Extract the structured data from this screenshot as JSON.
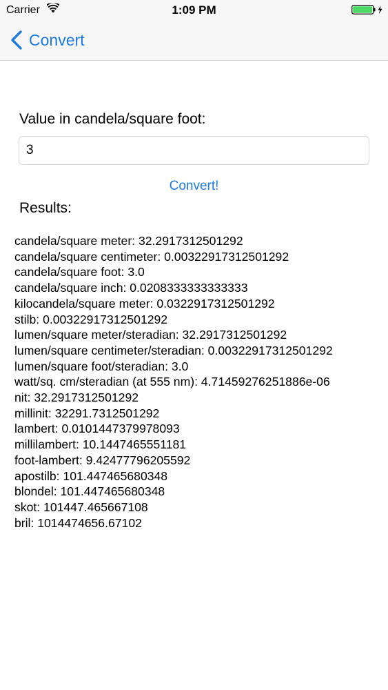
{
  "status_bar": {
    "carrier": "Carrier",
    "time": "1:09 PM",
    "battery_color": "#4cd964"
  },
  "nav": {
    "back_label": "Convert",
    "accent_color": "#1d7ae0"
  },
  "form": {
    "field_label": "Value in candela/square foot:",
    "input_value": "3",
    "convert_label": "Convert!"
  },
  "results": {
    "label": "Results:",
    "items": [
      "candela/square meter: 32.2917312501292",
      "candela/square centimeter: 0.00322917312501292",
      "candela/square foot: 3.0",
      "candela/square inch: 0.0208333333333333",
      "kilocandela/square meter: 0.0322917312501292",
      "stilb: 0.00322917312501292",
      "lumen/square meter/steradian: 32.2917312501292",
      "lumen/square centimeter/steradian: 0.00322917312501292",
      "lumen/square foot/steradian: 3.0",
      "watt/sq. cm/steradian (at 555 nm): 4.71459276251886e-06",
      "nit: 32.2917312501292",
      "millinit: 32291.7312501292",
      "lambert: 0.0101447379978093",
      "millilambert: 10.1447465551181",
      "foot-lambert: 9.42477796205592",
      "apostilb: 101.447465680348",
      "blondel: 101.447465680348",
      "skot: 101447.465667108",
      "bril: 1014474656.67102"
    ]
  }
}
